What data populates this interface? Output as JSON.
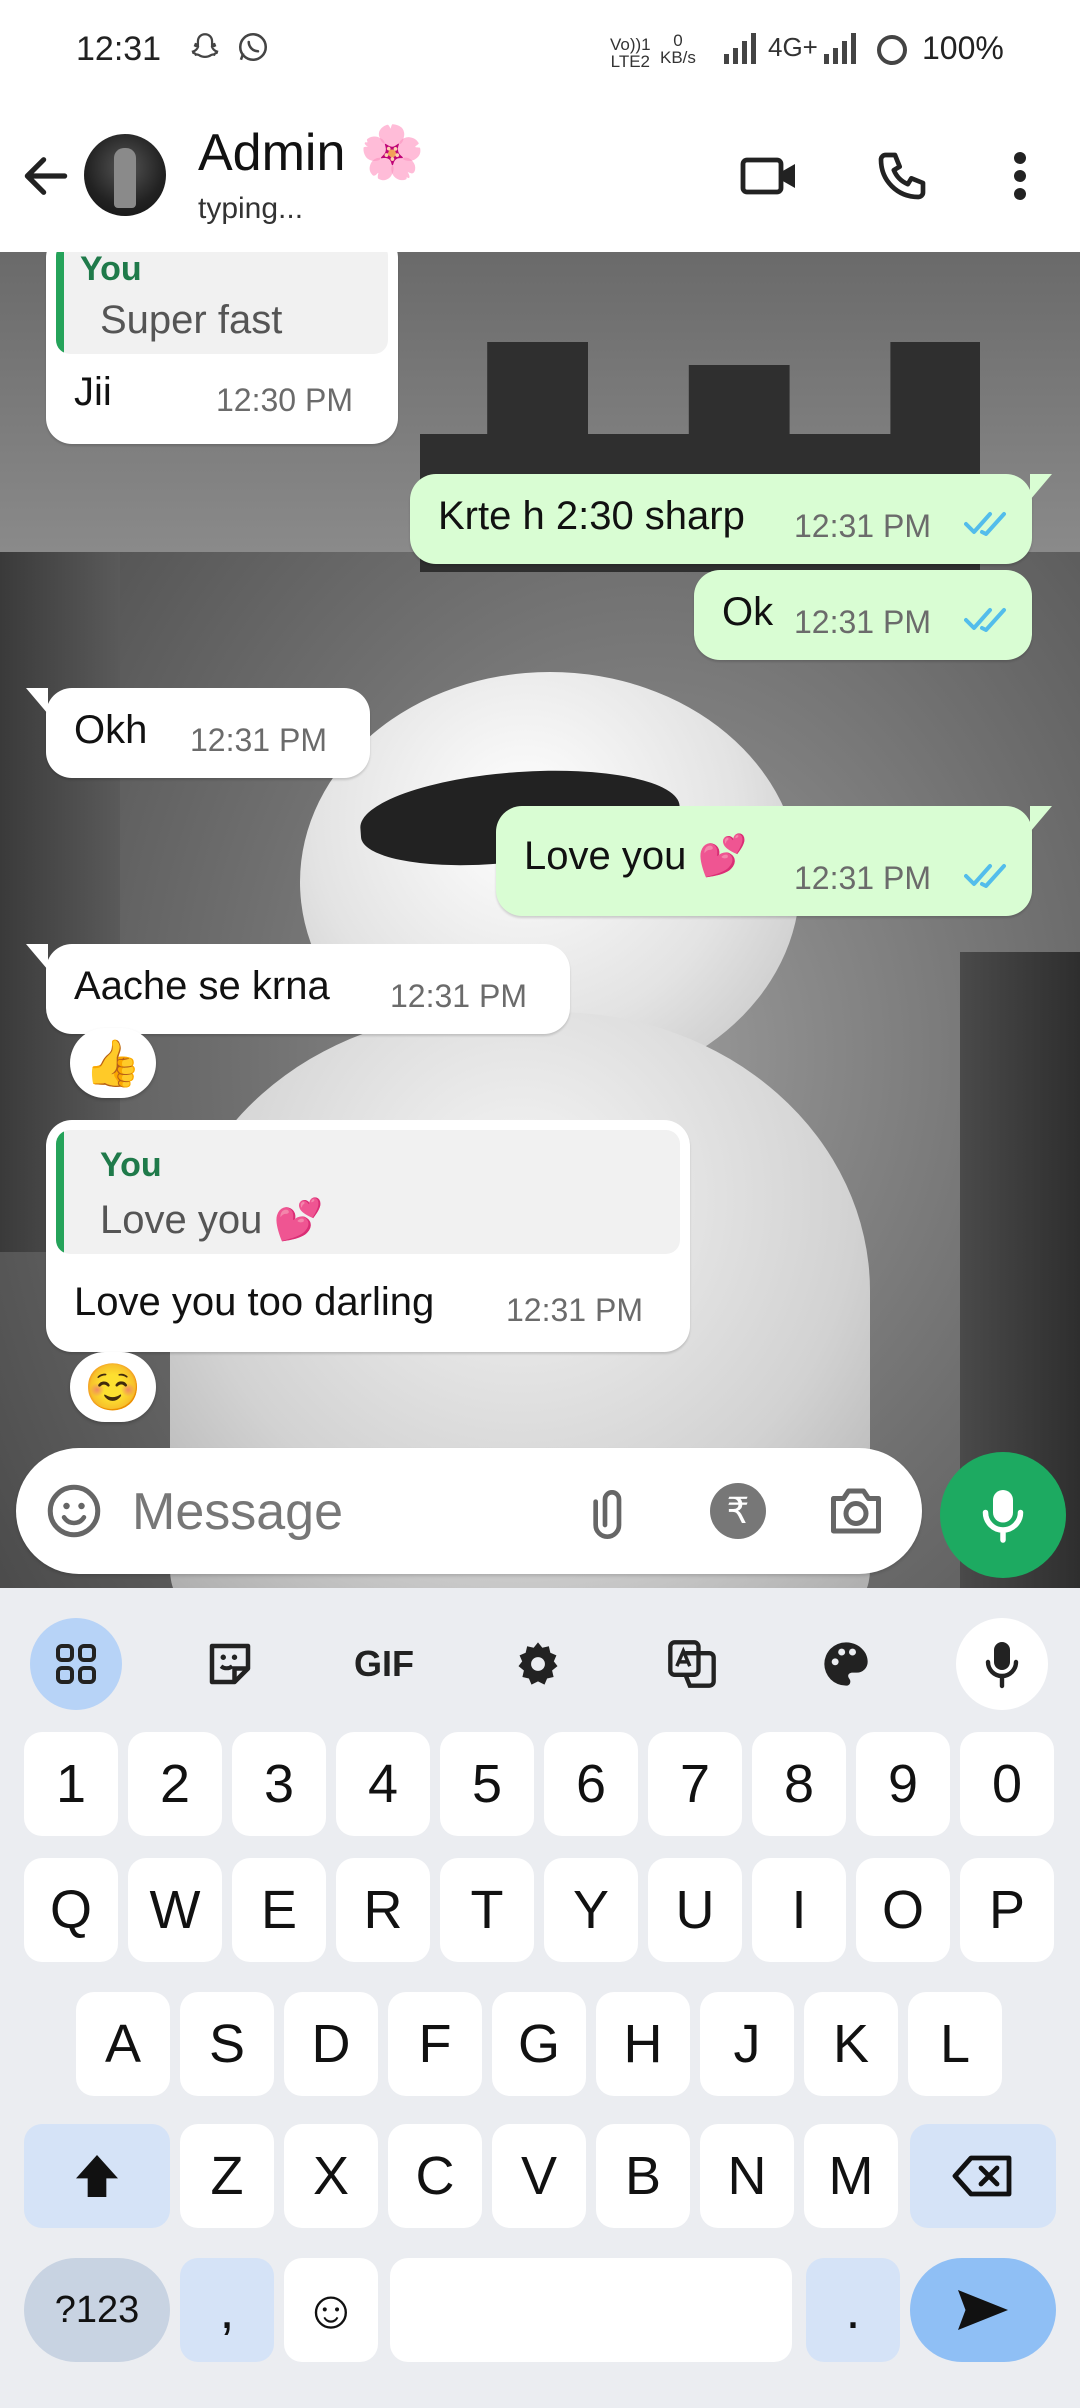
{
  "status_bar": {
    "time": "12:31",
    "volte_line1": "Vo))1",
    "volte_line2": "LTE2",
    "data_speed_line1": "0",
    "data_speed_line2": "KB/s",
    "network": "4G+",
    "battery": "100%"
  },
  "header": {
    "contact_name": "Admin 🌸",
    "status": "typing..."
  },
  "messages": [
    {
      "quote_author": "You",
      "quote_text": "Super fast",
      "text": "Jii",
      "time": "12:30 PM"
    },
    {
      "text": "Krte h 2:30 sharp",
      "time": "12:31 PM"
    },
    {
      "text": "Ok",
      "time": "12:31 PM"
    },
    {
      "text": "Okh",
      "time": "12:31 PM"
    },
    {
      "text": "Love you 💕",
      "time": "12:31 PM"
    },
    {
      "text": "Aache se krna",
      "time": "12:31 PM",
      "reaction": "👍"
    },
    {
      "quote_author": "You",
      "quote_text": "Love you 💕",
      "text": "Love you too darling",
      "time": "12:31 PM",
      "reaction": "☺️"
    }
  ],
  "composer": {
    "placeholder": "Message",
    "rupee_symbol": "₹"
  },
  "keyboard": {
    "gif_label": "GIF",
    "row_numbers": [
      "1",
      "2",
      "3",
      "4",
      "5",
      "6",
      "7",
      "8",
      "9",
      "0"
    ],
    "row1": [
      "Q",
      "W",
      "E",
      "R",
      "T",
      "Y",
      "U",
      "I",
      "O",
      "P"
    ],
    "row2": [
      "A",
      "S",
      "D",
      "F",
      "G",
      "H",
      "J",
      "K",
      "L"
    ],
    "row3": [
      "Z",
      "X",
      "C",
      "V",
      "B",
      "N",
      "M"
    ],
    "symbols_key": "?123",
    "comma_key": ",",
    "emoji_key": "☺",
    "period_key": "."
  },
  "colors": {
    "outgoing_bubble": "#d9fdd3",
    "incoming_bubble": "#ffffff",
    "accent_green": "#1daa61",
    "tick_blue": "#53bdeb",
    "quote_bar": "#25a35a"
  }
}
